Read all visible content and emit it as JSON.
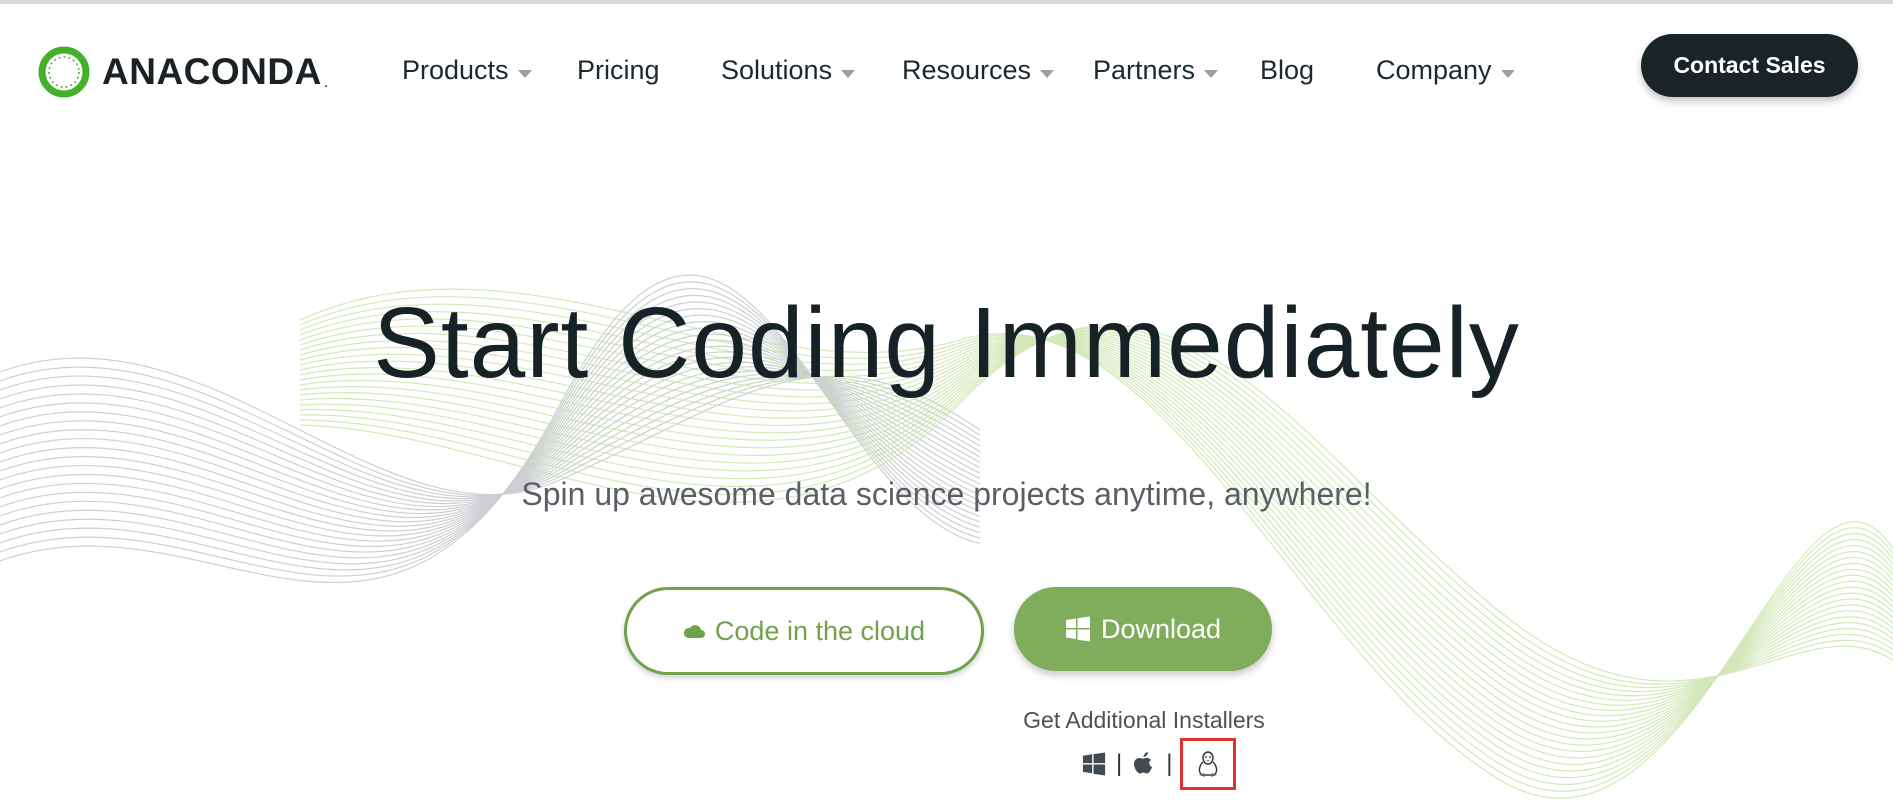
{
  "brand": {
    "name": "ANACONDA",
    "mark": "."
  },
  "nav": {
    "items": [
      {
        "label": "Products",
        "dropdown": true
      },
      {
        "label": "Pricing",
        "dropdown": false
      },
      {
        "label": "Solutions",
        "dropdown": true
      },
      {
        "label": "Resources",
        "dropdown": true
      },
      {
        "label": "Partners",
        "dropdown": true
      },
      {
        "label": "Blog",
        "dropdown": false
      },
      {
        "label": "Company",
        "dropdown": true
      }
    ],
    "contact_label": "Contact Sales"
  },
  "hero": {
    "title": "Start Coding Immediately",
    "subtitle": "Spin up awesome data science projects anytime, anywhere!",
    "cloud_button": "Code in the cloud",
    "download_button": "Download",
    "installers_label": "Get Additional Installers",
    "installers_separator": "|",
    "installers": [
      "windows-icon",
      "apple-icon",
      "linux-icon"
    ]
  },
  "colors": {
    "brand_green": "#6fa24a",
    "download_green": "#7fad5c",
    "dark": "#1a2326",
    "highlight_red": "#e03030"
  }
}
